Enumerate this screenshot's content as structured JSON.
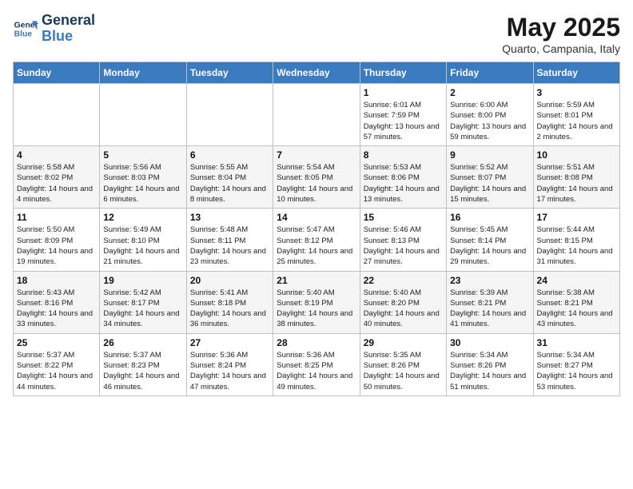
{
  "logo": {
    "line1": "General",
    "line2": "Blue"
  },
  "title": "May 2025",
  "subtitle": "Quarto, Campania, Italy",
  "days_of_week": [
    "Sunday",
    "Monday",
    "Tuesday",
    "Wednesday",
    "Thursday",
    "Friday",
    "Saturday"
  ],
  "weeks": [
    [
      {
        "num": "",
        "info": ""
      },
      {
        "num": "",
        "info": ""
      },
      {
        "num": "",
        "info": ""
      },
      {
        "num": "",
        "info": ""
      },
      {
        "num": "1",
        "info": "Sunrise: 6:01 AM\nSunset: 7:59 PM\nDaylight: 13 hours and 57 minutes."
      },
      {
        "num": "2",
        "info": "Sunrise: 6:00 AM\nSunset: 8:00 PM\nDaylight: 13 hours and 59 minutes."
      },
      {
        "num": "3",
        "info": "Sunrise: 5:59 AM\nSunset: 8:01 PM\nDaylight: 14 hours and 2 minutes."
      }
    ],
    [
      {
        "num": "4",
        "info": "Sunrise: 5:58 AM\nSunset: 8:02 PM\nDaylight: 14 hours and 4 minutes."
      },
      {
        "num": "5",
        "info": "Sunrise: 5:56 AM\nSunset: 8:03 PM\nDaylight: 14 hours and 6 minutes."
      },
      {
        "num": "6",
        "info": "Sunrise: 5:55 AM\nSunset: 8:04 PM\nDaylight: 14 hours and 8 minutes."
      },
      {
        "num": "7",
        "info": "Sunrise: 5:54 AM\nSunset: 8:05 PM\nDaylight: 14 hours and 10 minutes."
      },
      {
        "num": "8",
        "info": "Sunrise: 5:53 AM\nSunset: 8:06 PM\nDaylight: 14 hours and 13 minutes."
      },
      {
        "num": "9",
        "info": "Sunrise: 5:52 AM\nSunset: 8:07 PM\nDaylight: 14 hours and 15 minutes."
      },
      {
        "num": "10",
        "info": "Sunrise: 5:51 AM\nSunset: 8:08 PM\nDaylight: 14 hours and 17 minutes."
      }
    ],
    [
      {
        "num": "11",
        "info": "Sunrise: 5:50 AM\nSunset: 8:09 PM\nDaylight: 14 hours and 19 minutes."
      },
      {
        "num": "12",
        "info": "Sunrise: 5:49 AM\nSunset: 8:10 PM\nDaylight: 14 hours and 21 minutes."
      },
      {
        "num": "13",
        "info": "Sunrise: 5:48 AM\nSunset: 8:11 PM\nDaylight: 14 hours and 23 minutes."
      },
      {
        "num": "14",
        "info": "Sunrise: 5:47 AM\nSunset: 8:12 PM\nDaylight: 14 hours and 25 minutes."
      },
      {
        "num": "15",
        "info": "Sunrise: 5:46 AM\nSunset: 8:13 PM\nDaylight: 14 hours and 27 minutes."
      },
      {
        "num": "16",
        "info": "Sunrise: 5:45 AM\nSunset: 8:14 PM\nDaylight: 14 hours and 29 minutes."
      },
      {
        "num": "17",
        "info": "Sunrise: 5:44 AM\nSunset: 8:15 PM\nDaylight: 14 hours and 31 minutes."
      }
    ],
    [
      {
        "num": "18",
        "info": "Sunrise: 5:43 AM\nSunset: 8:16 PM\nDaylight: 14 hours and 33 minutes."
      },
      {
        "num": "19",
        "info": "Sunrise: 5:42 AM\nSunset: 8:17 PM\nDaylight: 14 hours and 34 minutes."
      },
      {
        "num": "20",
        "info": "Sunrise: 5:41 AM\nSunset: 8:18 PM\nDaylight: 14 hours and 36 minutes."
      },
      {
        "num": "21",
        "info": "Sunrise: 5:40 AM\nSunset: 8:19 PM\nDaylight: 14 hours and 38 minutes."
      },
      {
        "num": "22",
        "info": "Sunrise: 5:40 AM\nSunset: 8:20 PM\nDaylight: 14 hours and 40 minutes."
      },
      {
        "num": "23",
        "info": "Sunrise: 5:39 AM\nSunset: 8:21 PM\nDaylight: 14 hours and 41 minutes."
      },
      {
        "num": "24",
        "info": "Sunrise: 5:38 AM\nSunset: 8:21 PM\nDaylight: 14 hours and 43 minutes."
      }
    ],
    [
      {
        "num": "25",
        "info": "Sunrise: 5:37 AM\nSunset: 8:22 PM\nDaylight: 14 hours and 44 minutes."
      },
      {
        "num": "26",
        "info": "Sunrise: 5:37 AM\nSunset: 8:23 PM\nDaylight: 14 hours and 46 minutes."
      },
      {
        "num": "27",
        "info": "Sunrise: 5:36 AM\nSunset: 8:24 PM\nDaylight: 14 hours and 47 minutes."
      },
      {
        "num": "28",
        "info": "Sunrise: 5:36 AM\nSunset: 8:25 PM\nDaylight: 14 hours and 49 minutes."
      },
      {
        "num": "29",
        "info": "Sunrise: 5:35 AM\nSunset: 8:26 PM\nDaylight: 14 hours and 50 minutes."
      },
      {
        "num": "30",
        "info": "Sunrise: 5:34 AM\nSunset: 8:26 PM\nDaylight: 14 hours and 51 minutes."
      },
      {
        "num": "31",
        "info": "Sunrise: 5:34 AM\nSunset: 8:27 PM\nDaylight: 14 hours and 53 minutes."
      }
    ]
  ]
}
